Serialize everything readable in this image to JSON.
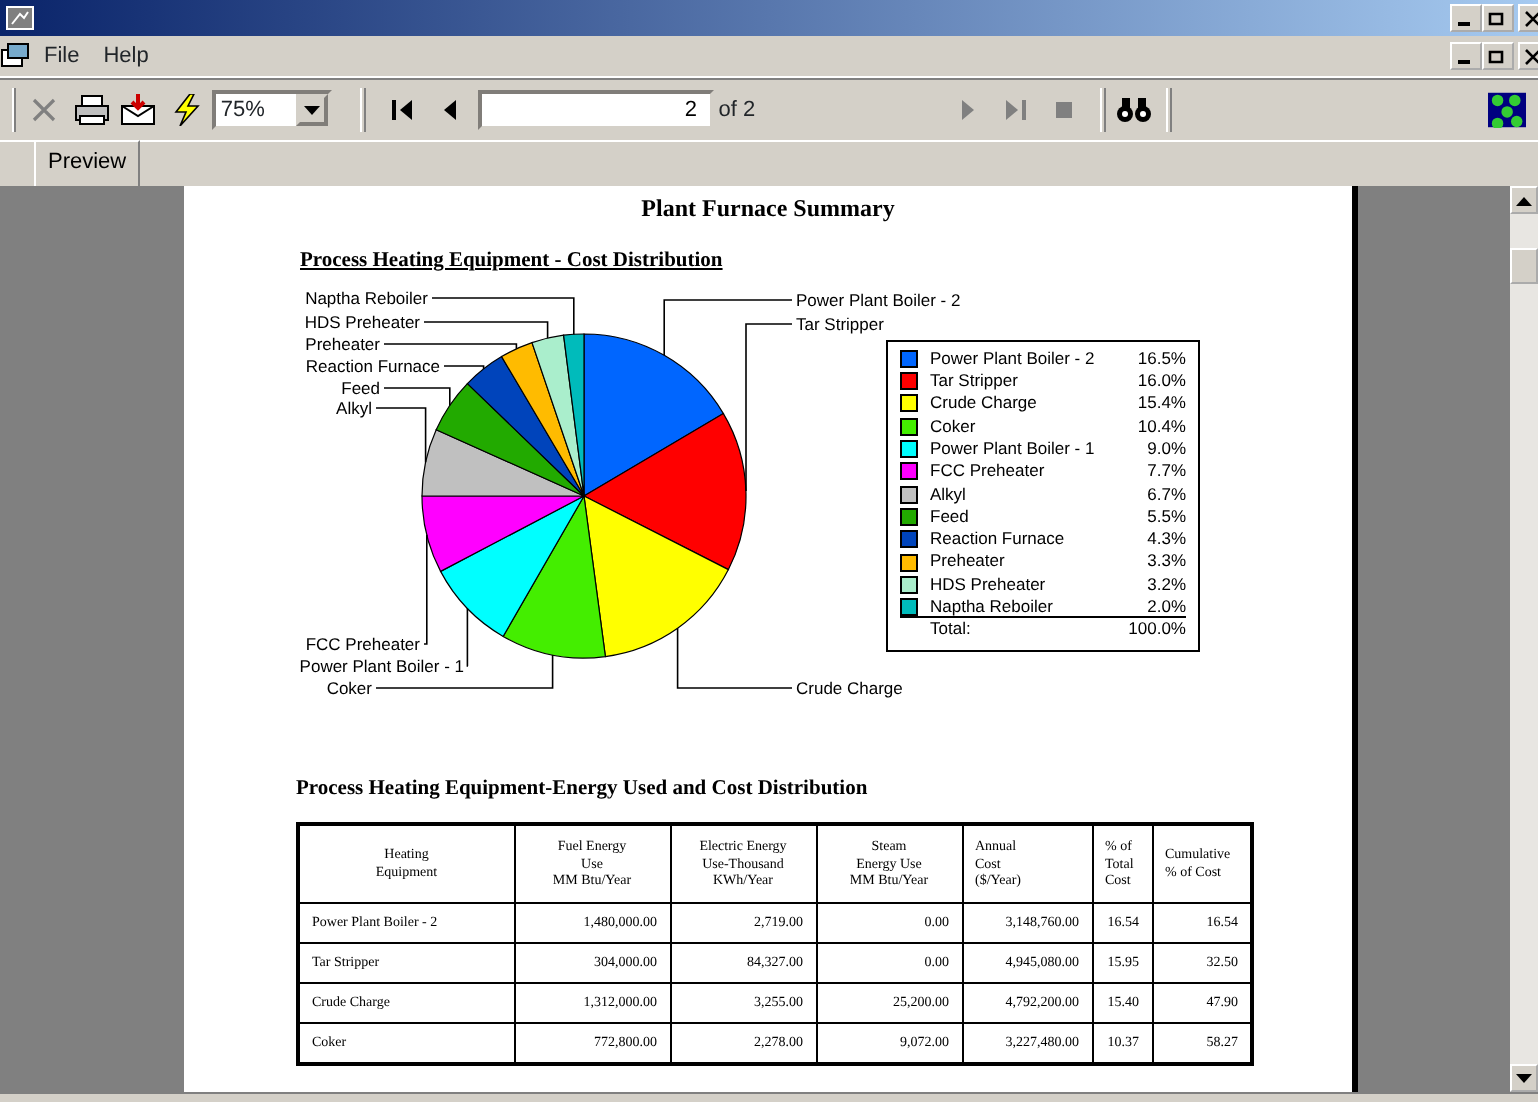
{
  "menu": [
    {
      "label": "File"
    },
    {
      "label": "Help"
    }
  ],
  "toolbar": {
    "buttons": [
      {
        "kind": "close",
        "disabled": true
      },
      {
        "kind": "print",
        "disabled": false
      },
      {
        "kind": "export",
        "disabled": false
      },
      {
        "kind": "refresh",
        "disabled": false
      }
    ],
    "zoom": "75%",
    "nav": [
      {
        "kind": "first",
        "disabled": false
      },
      {
        "kind": "prev",
        "disabled": false
      }
    ],
    "page": "2",
    "page_total": "of 2",
    "nav2": [
      {
        "kind": "next",
        "disabled": true
      },
      {
        "kind": "last",
        "disabled": true
      },
      {
        "kind": "stop",
        "disabled": true
      }
    ]
  },
  "tabs": [
    {
      "label": "Preview",
      "selected": true
    }
  ],
  "report": {
    "title": "Plant Furnace Summary",
    "chart_heading": "Process Heating Equipment - Cost Distribution",
    "chart_data": {
      "type": "pie",
      "categories": [
        "Power Plant Boiler - 2",
        "Tar Stripper",
        "Crude Charge",
        "Coker",
        "Power Plant Boiler - 1",
        "FCC Preheater",
        "Alkyl",
        "Feed",
        "Reaction Furnace",
        "Preheater",
        "HDS Preheater",
        "Naptha Reboiler"
      ],
      "values": [
        16.5,
        16.0,
        15.4,
        10.4,
        9.0,
        7.7,
        6.7,
        5.5,
        4.3,
        3.3,
        3.2,
        2.0
      ]
    },
    "legend": [
      {
        "label": "Power Plant Boiler - 2",
        "percent": "16.5%",
        "color": "#0066ff"
      },
      {
        "label": "Tar Stripper",
        "percent": "16.0%",
        "color": "#ff0000"
      },
      {
        "label": "Crude Charge",
        "percent": "15.4%",
        "color": "#ffff00"
      },
      {
        "label": "Coker",
        "percent": "10.4%",
        "color": "#44ee00"
      },
      {
        "label": "Power Plant Boiler - 1",
        "percent": "9.0%",
        "color": "#00ffff"
      },
      {
        "label": "FCC Preheater",
        "percent": "7.7%",
        "color": "#ff00ff"
      },
      {
        "label": "Alkyl",
        "percent": "6.7%",
        "color": "#c0c0c0"
      },
      {
        "label": "Feed",
        "percent": "5.5%",
        "color": "#22aa00"
      },
      {
        "label": "Reaction Furnace",
        "percent": "4.3%",
        "color": "#0044bb"
      },
      {
        "label": "Preheater",
        "percent": "3.3%",
        "color": "#ffbb00"
      },
      {
        "label": "HDS Preheater",
        "percent": "3.2%",
        "color": "#aaeecc"
      },
      {
        "label": "Naptha Reboiler",
        "percent": "2.0%",
        "color": "#00bbbb"
      }
    ],
    "legend_total": {
      "label": "Total:",
      "value": "100.0%"
    },
    "table_heading": "Process Heating Equipment-Energy Used and Cost Distribution",
    "table": {
      "columns": [
        "Heating\nEquipment",
        "Fuel Energy\nUse\nMM Btu/Year",
        "Electric Energy\nUse-Thousand\nKWh/Year",
        "Steam\nEnergy Use\nMM Btu/Year",
        "Annual\nCost\n($/Year)",
        "% of\nTotal\nCost",
        "Cumulative\n% of Cost"
      ],
      "rows": [
        [
          "Power Plant Boiler - 2",
          "1,480,000.00",
          "2,719.00",
          "0.00",
          "3,148,760.00",
          "16.54",
          "16.54"
        ],
        [
          "Tar Stripper",
          "304,000.00",
          "84,327.00",
          "0.00",
          "4,945,080.00",
          "15.95",
          "32.50"
        ],
        [
          "Crude Charge",
          "1,312,000.00",
          "3,255.00",
          "25,200.00",
          "4,792,200.00",
          "15.40",
          "47.90"
        ],
        [
          "Coker",
          "772,800.00",
          "2,278.00",
          "9,072.00",
          "3,227,480.00",
          "10.37",
          "58.27"
        ]
      ]
    }
  }
}
